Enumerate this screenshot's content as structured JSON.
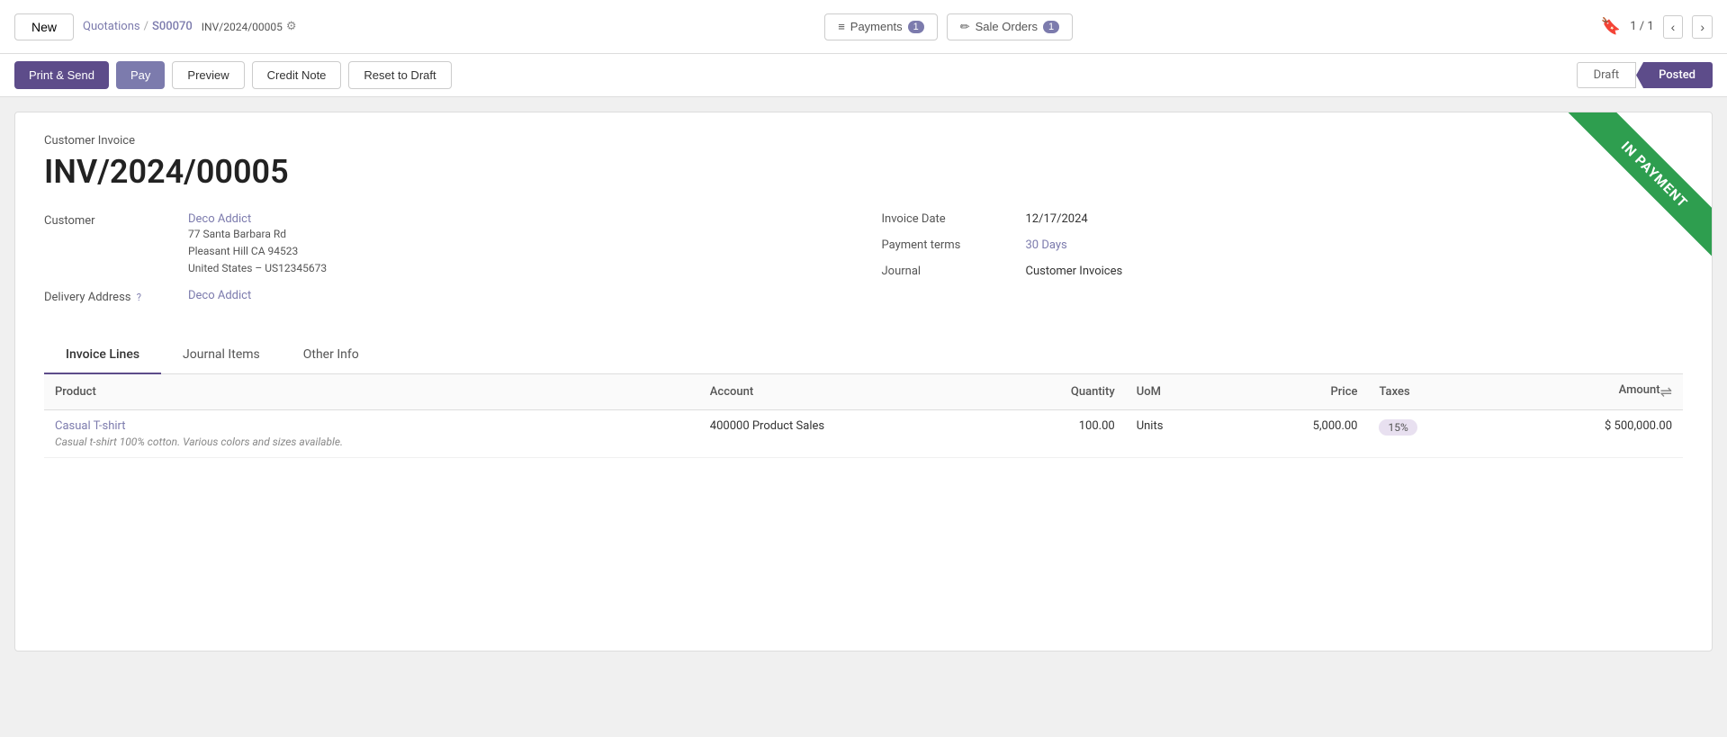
{
  "topbar": {
    "new_label": "New",
    "breadcrumb": {
      "parent": "Quotations",
      "separator": "/",
      "child": "S00070"
    },
    "invoice_ref": "INV/2024/00005",
    "payments_label": "Payments",
    "payments_count": "1",
    "sale_orders_label": "Sale Orders",
    "sale_orders_count": "1",
    "nav_counter": "1 / 1"
  },
  "actionbar": {
    "print_send_label": "Print & Send",
    "pay_label": "Pay",
    "preview_label": "Preview",
    "credit_note_label": "Credit Note",
    "reset_draft_label": "Reset to Draft",
    "status_draft": "Draft",
    "status_posted": "Posted"
  },
  "form": {
    "subtitle": "Customer Invoice",
    "invoice_number": "INV/2024/00005",
    "customer_label": "Customer",
    "customer_name": "Deco Addict",
    "customer_address_1": "77 Santa Barbara Rd",
    "customer_address_2": "Pleasant Hill CA 94523",
    "customer_address_3": "United States – US12345673",
    "delivery_address_label": "Delivery Address",
    "delivery_address_name": "Deco Addict",
    "invoice_date_label": "Invoice Date",
    "invoice_date_value": "12/17/2024",
    "payment_terms_label": "Payment terms",
    "payment_terms_value": "30 Days",
    "journal_label": "Journal",
    "journal_value": "Customer Invoices",
    "ribbon_text": "IN PAYMENT"
  },
  "tabs": {
    "invoice_lines_label": "Invoice Lines",
    "journal_items_label": "Journal Items",
    "other_info_label": "Other Info"
  },
  "table": {
    "headers": {
      "product": "Product",
      "account": "Account",
      "quantity": "Quantity",
      "uom": "UoM",
      "price": "Price",
      "taxes": "Taxes",
      "amount": "Amount"
    },
    "rows": [
      {
        "product_name": "Casual T-shirt",
        "product_desc": "Casual t-shirt 100% cotton. Various colors and sizes available.",
        "account": "400000 Product Sales",
        "quantity": "100.00",
        "uom": "Units",
        "price": "5,000.00",
        "taxes": "15%",
        "amount": "$ 500,000.00"
      }
    ]
  }
}
